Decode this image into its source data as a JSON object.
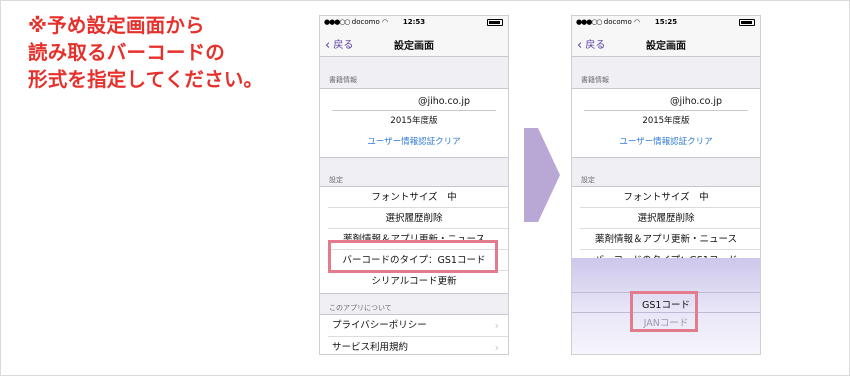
{
  "instruction": {
    "lines": [
      "※予め設定画面から",
      "読み取るバーコードの",
      "形式を指定してください。"
    ]
  },
  "colors": {
    "instruction_text": "#e6302b",
    "accent": "#5b3d9e",
    "link": "#2f7ad6",
    "highlight": "#e27b8c",
    "arrow": "#b9a7d6"
  },
  "left_phone": {
    "status": {
      "signal": "●●●○○",
      "carrier": "docomo",
      "time": "12:53"
    },
    "nav": {
      "back_label": "戻る",
      "title": "設定画面"
    },
    "book_info": {
      "header": "書籍情報",
      "email": "@jiho.co.jp",
      "edition": "2015年度版",
      "clear_link": "ユーザー情報認証クリア"
    },
    "settings": {
      "header": "設定",
      "items": [
        "フォントサイズ　中",
        "選択履歴削除",
        "薬剤情報＆アプリ更新・ニュース",
        "バーコードのタイプ：GS1コード",
        "シリアルコード更新"
      ]
    },
    "about": {
      "header": "このアプリについて",
      "items": [
        "プライバシーポリシー",
        "サービス利用規約"
      ]
    }
  },
  "right_phone": {
    "status": {
      "signal": "●●●○○",
      "carrier": "docomo",
      "time": "15:25"
    },
    "nav": {
      "back_label": "戻る",
      "title": "設定画面"
    },
    "book_info": {
      "header": "書籍情報",
      "email": "@jiho.co.jp",
      "edition": "2015年度版",
      "clear_link": "ユーザー情報認証クリア"
    },
    "settings": {
      "header": "設定",
      "items": [
        "フォントサイズ　中",
        "選択履歴削除",
        "薬剤情報＆アプリ更新・ニュース",
        "バーコードのタイプ：GS1コード"
      ]
    },
    "picker": {
      "options": [
        "GS1コード",
        "JANコード"
      ],
      "selected": "GS1コード"
    }
  }
}
